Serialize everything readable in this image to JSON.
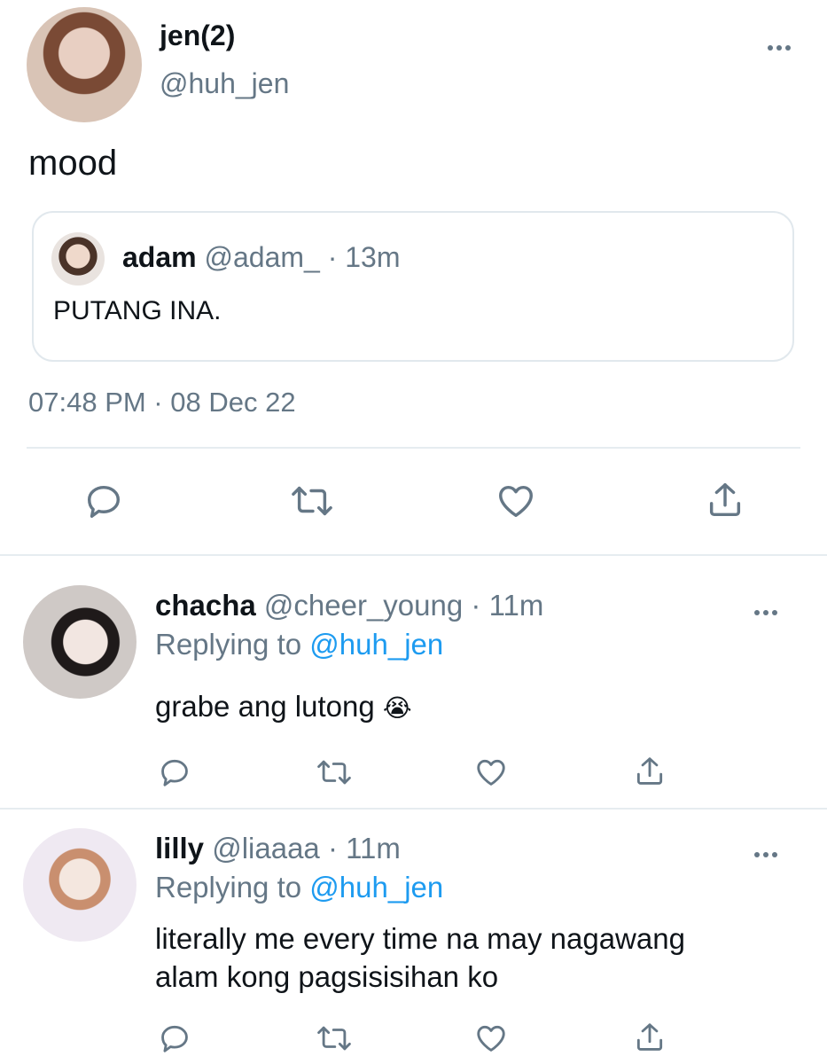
{
  "main_tweet": {
    "display_name": "jen(2)",
    "handle": "@huh_jen",
    "text": "mood",
    "timestamp": "07:48 PM · 08 Dec 22",
    "quoted": {
      "display_name": "adam",
      "handle": "@adam_",
      "separator": "·",
      "time": "13m",
      "text": "PUTANG INA."
    }
  },
  "replies": [
    {
      "display_name": "chacha",
      "handle": "@cheer_young",
      "separator": "·",
      "time": "11m",
      "replying_prefix": "Replying to",
      "replying_handle": "@huh_jen",
      "text": "grabe ang lutong",
      "emoji": "😭"
    },
    {
      "display_name": "lilly",
      "handle": "@liaaaa",
      "separator": "·",
      "time": "11m",
      "replying_prefix": "Replying to",
      "replying_handle": "@huh_jen",
      "text_line1": "literally me every time na may nagawang",
      "text_line2": "alam kong pagsisisihan ko"
    }
  ],
  "icons": [
    "reply-icon",
    "retweet-icon",
    "like-icon",
    "share-icon",
    "more-icon"
  ],
  "colors": {
    "link": "#1d9bf0",
    "muted": "#657786",
    "icon": "#657786",
    "divider": "#e6ecf0"
  }
}
